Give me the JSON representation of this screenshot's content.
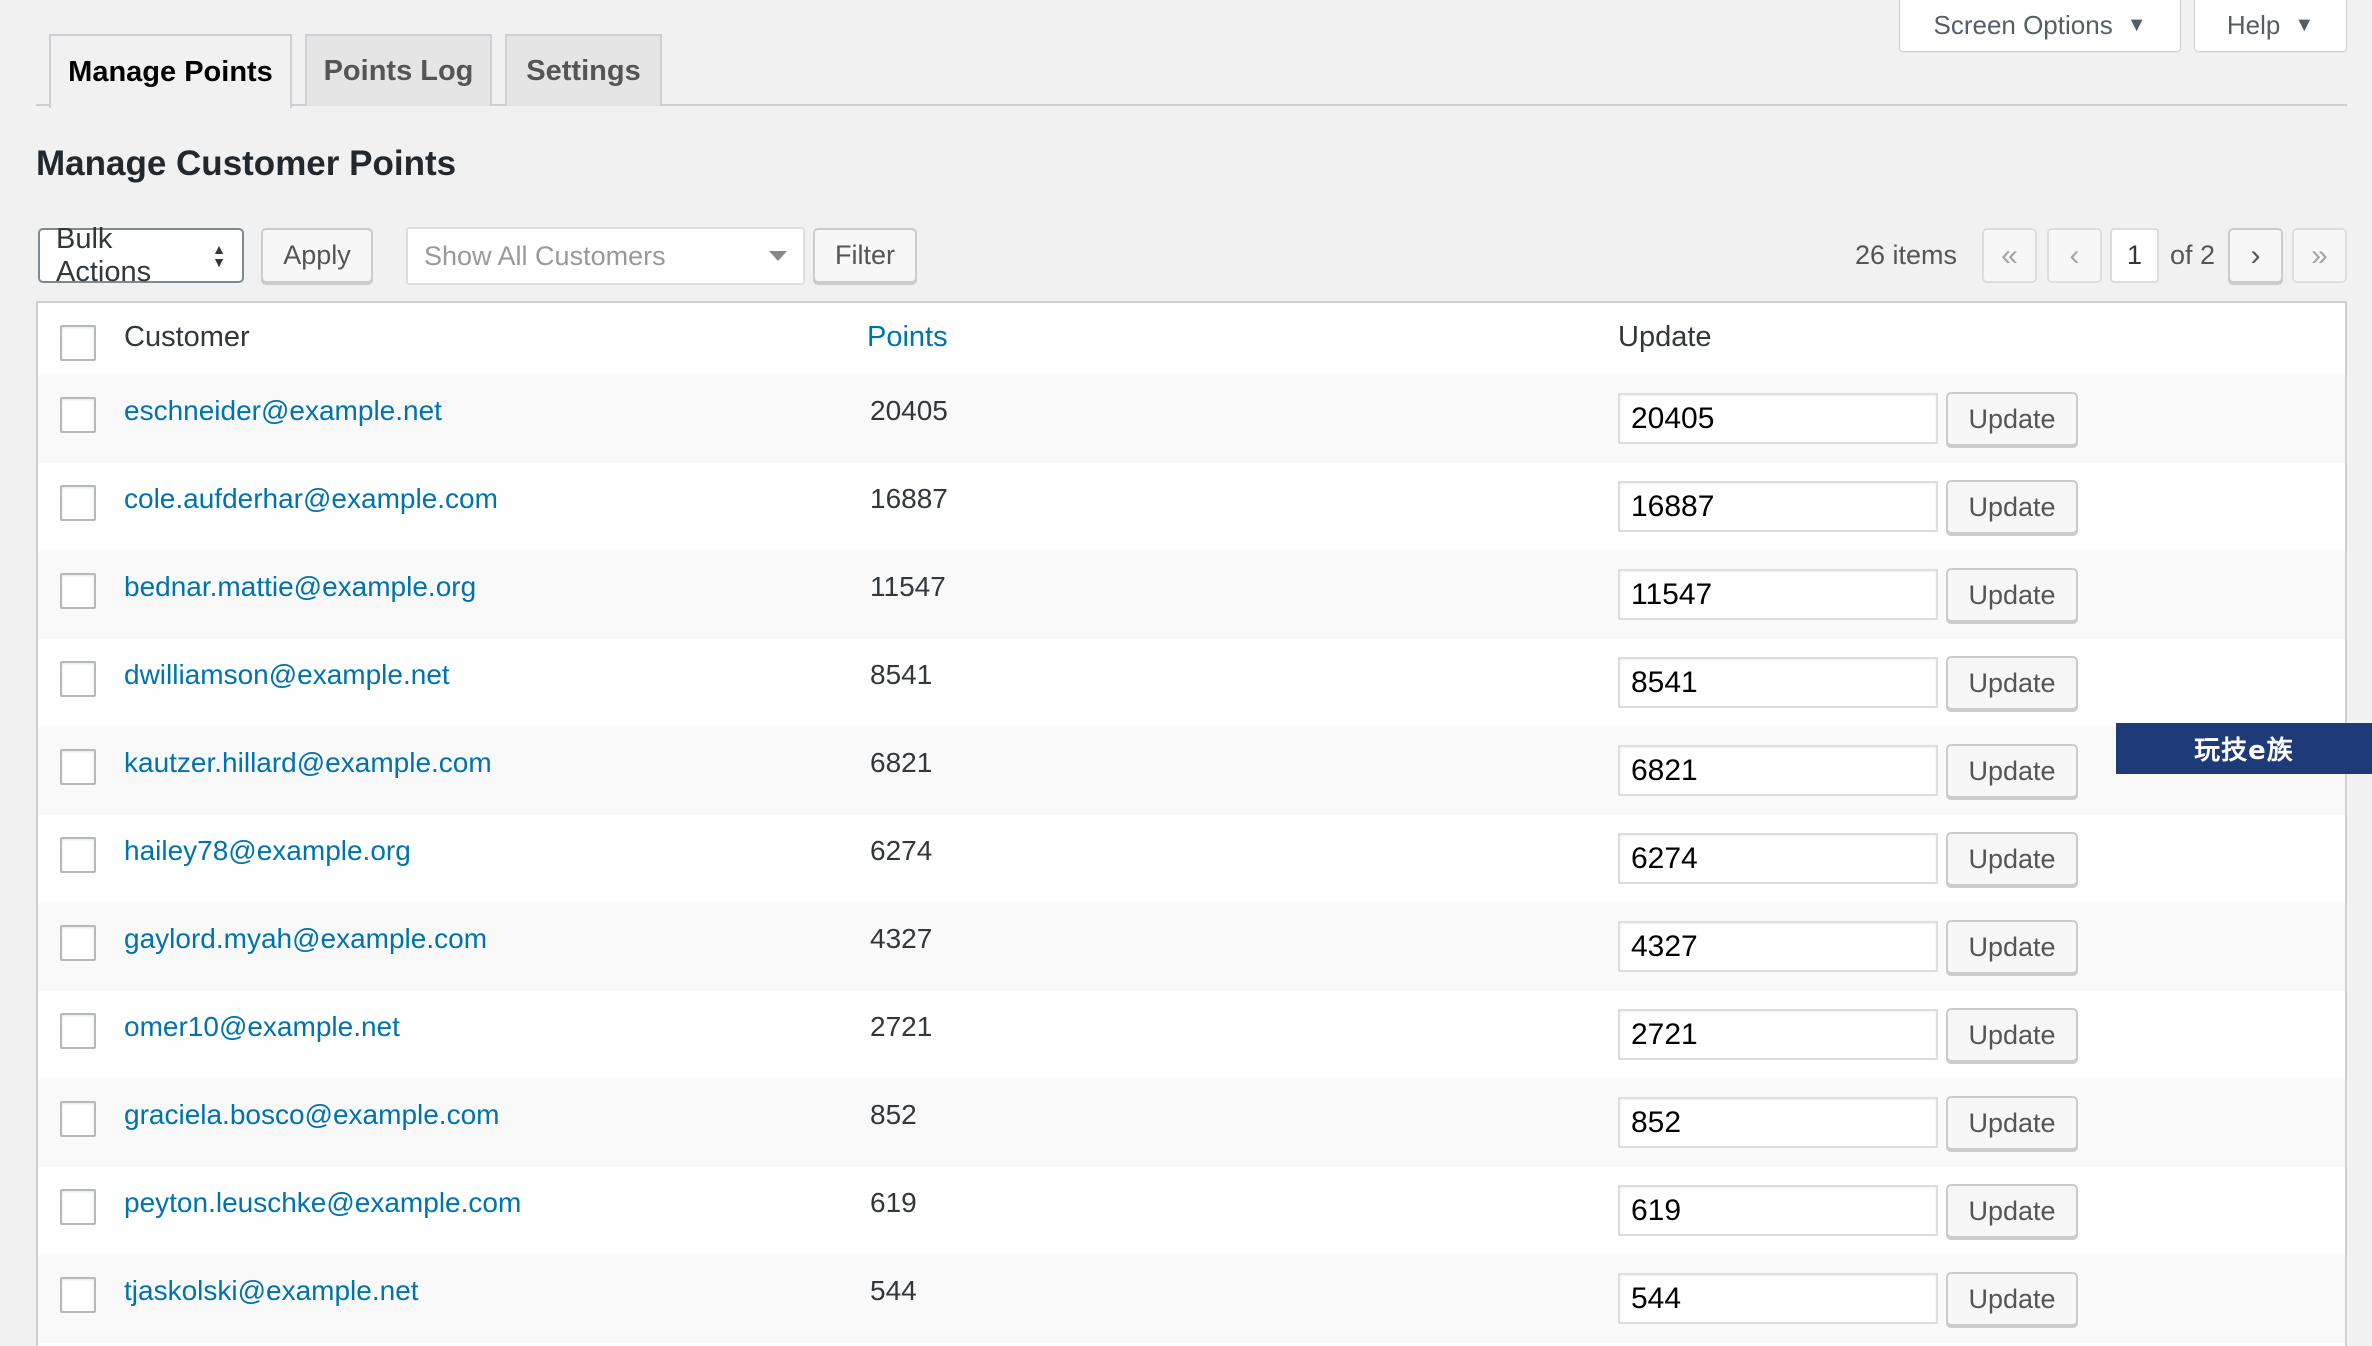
{
  "screen_meta": {
    "screen_options_label": "Screen Options",
    "help_label": "Help"
  },
  "nav_tabs": [
    {
      "label": "Manage Points",
      "active": true
    },
    {
      "label": "Points Log",
      "active": false
    },
    {
      "label": "Settings",
      "active": false
    }
  ],
  "page_title": "Manage Customer Points",
  "toolbar": {
    "bulk_actions": "Bulk Actions",
    "apply_label": "Apply",
    "customer_filter_placeholder": "Show All Customers",
    "filter_label": "Filter",
    "items_count": "26 items",
    "first_page": "«",
    "prev_page": "‹",
    "current_page": "1",
    "of_pages": "of 2",
    "next_page": "›",
    "last_page": "»"
  },
  "table": {
    "columns": {
      "customer": "Customer",
      "points": "Points",
      "update": "Update"
    },
    "update_button_label": "Update",
    "rows": [
      {
        "email": "eschneider@example.net",
        "points": "20405",
        "input": "20405"
      },
      {
        "email": "cole.aufderhar@example.com",
        "points": "16887",
        "input": "16887"
      },
      {
        "email": "bednar.mattie@example.org",
        "points": "11547",
        "input": "11547"
      },
      {
        "email": "dwilliamson@example.net",
        "points": "8541",
        "input": "8541"
      },
      {
        "email": "kautzer.hillard@example.com",
        "points": "6821",
        "input": "6821"
      },
      {
        "email": "hailey78@example.org",
        "points": "6274",
        "input": "6274"
      },
      {
        "email": "gaylord.myah@example.com",
        "points": "4327",
        "input": "4327"
      },
      {
        "email": "omer10@example.net",
        "points": "2721",
        "input": "2721"
      },
      {
        "email": "graciela.bosco@example.com",
        "points": "852",
        "input": "852"
      },
      {
        "email": "peyton.leuschke@example.com",
        "points": "619",
        "input": "619"
      },
      {
        "email": "tjaskolski@example.net",
        "points": "544",
        "input": "544"
      }
    ]
  },
  "watermark": "玩技e族",
  "colors": {
    "link": "#0073aa",
    "background": "#f1f1f1",
    "border": "#ccd0d4"
  }
}
